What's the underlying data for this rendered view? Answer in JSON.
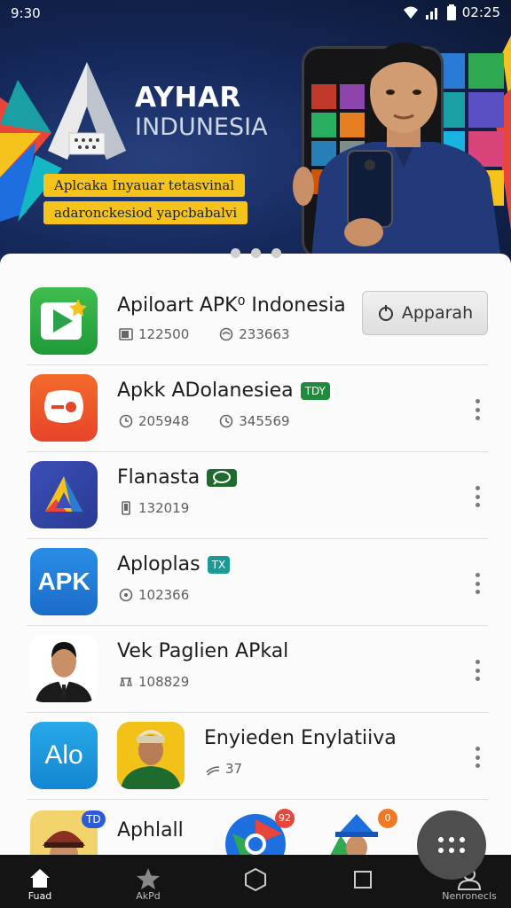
{
  "status_bar": {
    "time": "9:30",
    "clock_right": "02:25"
  },
  "banner": {
    "brand_line1": "AYHAR",
    "brand_line2": "INDUNESIA",
    "tagline1": "Aplcaka Inyauar tetasvinal",
    "tagline2": "adaronckesiod yapcbabalvi",
    "carousel_pages": 3
  },
  "apps": [
    {
      "title": "Apiloart APK⁰ Indonesia",
      "stat1": "122500",
      "stat2": "233663",
      "action": "Apparah"
    },
    {
      "title": "Apkk ADolanesiea",
      "badge": "TDY",
      "stat1": "205948",
      "stat2": "345569"
    },
    {
      "title": "Flanasta",
      "stat1": "132019"
    },
    {
      "title": "Aploplas",
      "badge": "TX",
      "stat1": "102366",
      "icon_text": "APK"
    },
    {
      "title": "Vek Paglien APkal",
      "stat1": "108829"
    },
    {
      "title": "Enyieden Enylatiiva",
      "stat1": "37",
      "icon_text": "Alo"
    },
    {
      "title": "Aphlall",
      "badge": "TD",
      "notif1": "92",
      "notif2": "0"
    }
  ],
  "nav": [
    {
      "label": "Fuad",
      "icon": "home-icon"
    },
    {
      "label": "AkPd",
      "icon": "star-icon"
    },
    {
      "label": "",
      "icon": "hexagon-icon"
    },
    {
      "label": "",
      "icon": "square-icon"
    },
    {
      "label": "Nenronecls",
      "icon": "person-icon"
    }
  ],
  "colors": {
    "accent_yellow": "#f6c21c",
    "badge_green": "#1e8a3c",
    "badge_teal": "#1a9a94"
  }
}
